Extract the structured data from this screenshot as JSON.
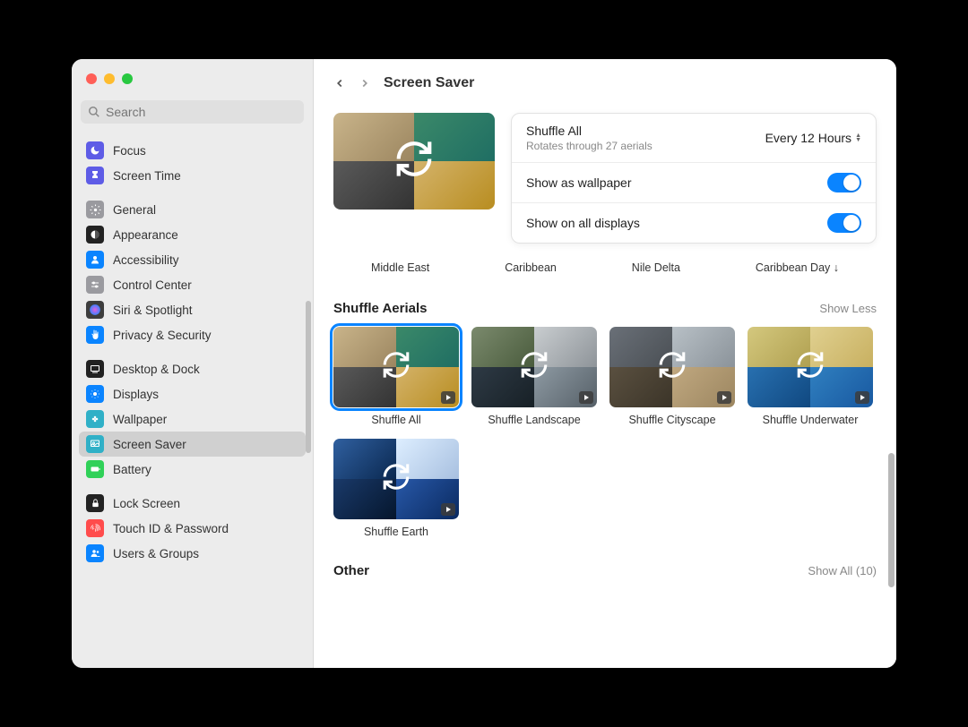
{
  "header": {
    "title": "Screen Saver",
    "search_placeholder": "Search"
  },
  "sidebar": {
    "groups": [
      [
        {
          "label": "Focus",
          "icon_bg": "#5e5ce6",
          "icon": "moon"
        },
        {
          "label": "Screen Time",
          "icon_bg": "#5e5ce6",
          "icon": "hourglass"
        }
      ],
      [
        {
          "label": "General",
          "icon_bg": "#9a9a9f",
          "icon": "gear"
        },
        {
          "label": "Appearance",
          "icon_bg": "#222",
          "icon": "appearance"
        },
        {
          "label": "Accessibility",
          "icon_bg": "#0a84ff",
          "icon": "person"
        },
        {
          "label": "Control Center",
          "icon_bg": "#9a9a9f",
          "icon": "sliders"
        },
        {
          "label": "Siri & Spotlight",
          "icon_bg": "#3d3d3d",
          "icon": "siri"
        },
        {
          "label": "Privacy & Security",
          "icon_bg": "#0a84ff",
          "icon": "hand"
        }
      ],
      [
        {
          "label": "Desktop & Dock",
          "icon_bg": "#222",
          "icon": "dock"
        },
        {
          "label": "Displays",
          "icon_bg": "#0a84ff",
          "icon": "display"
        },
        {
          "label": "Wallpaper",
          "icon_bg": "#30b0c7",
          "icon": "flower"
        },
        {
          "label": "Screen Saver",
          "icon_bg": "#30b0c7",
          "icon": "screensaver",
          "active": true
        },
        {
          "label": "Battery",
          "icon_bg": "#30d158",
          "icon": "battery"
        }
      ],
      [
        {
          "label": "Lock Screen",
          "icon_bg": "#222",
          "icon": "lock"
        },
        {
          "label": "Touch ID & Password",
          "icon_bg": "#ff4c4c",
          "icon": "fingerprint"
        },
        {
          "label": "Users & Groups",
          "icon_bg": "#0a84ff",
          "icon": "users"
        }
      ]
    ]
  },
  "settings": {
    "shuffle_title": "Shuffle All",
    "shuffle_subtitle": "Rotates through 27 aerials",
    "interval_value": "Every 12 Hours",
    "wallpaper_label": "Show as wallpaper",
    "all_displays_label": "Show on all displays"
  },
  "peek_labels": [
    "Middle East",
    "Caribbean",
    "Nile Delta",
    "Caribbean Day ↓"
  ],
  "sections": [
    {
      "title": "Shuffle Aerials",
      "action": "Show Less",
      "items": [
        {
          "label": "Shuffle All",
          "selected": true,
          "quad_class": ""
        },
        {
          "label": "Shuffle Landscape",
          "selected": false,
          "quad_class": "landscape-q"
        },
        {
          "label": "Shuffle Cityscape",
          "selected": false,
          "quad_class": "cityscape-q"
        },
        {
          "label": "Shuffle Underwater",
          "selected": false,
          "quad_class": "underwater-q"
        },
        {
          "label": "Shuffle Earth",
          "selected": false,
          "quad_class": "earth-q"
        }
      ]
    },
    {
      "title": "Other",
      "action": "Show All (10)",
      "items": []
    }
  ]
}
